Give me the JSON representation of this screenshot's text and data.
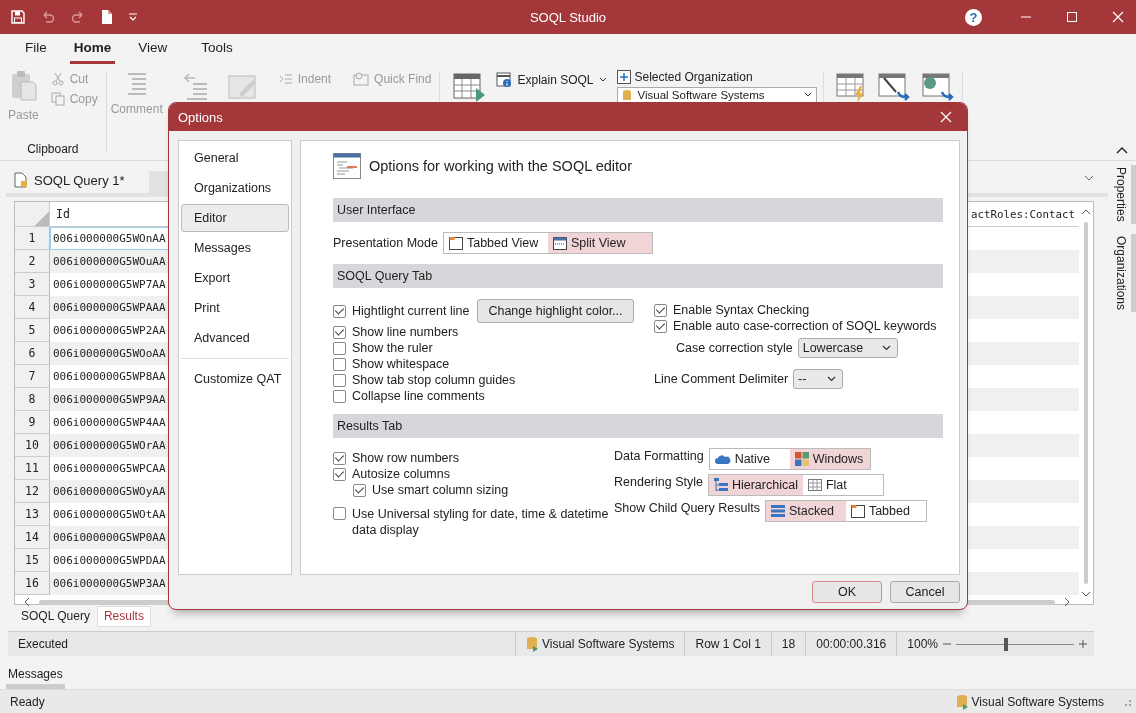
{
  "window": {
    "title": "SOQL Studio",
    "help": "?"
  },
  "menu_tabs": [
    {
      "label": "File",
      "selected": false
    },
    {
      "label": "Home",
      "selected": true
    },
    {
      "label": "View",
      "selected": false
    },
    {
      "label": "Tools",
      "selected": false
    }
  ],
  "ribbon": {
    "clipboard": {
      "label": "Clipboard",
      "paste": {
        "label": "Paste",
        "disabled": true
      },
      "cut": {
        "label": "Cut",
        "disabled": true
      },
      "copy": {
        "label": "Copy",
        "disabled": true
      }
    },
    "comment": {
      "label": "Comment",
      "disabled": true
    },
    "indent": {
      "label": "Indent",
      "disabled": true
    },
    "quick_find": {
      "label": "Quick Find",
      "disabled": true
    },
    "explain": {
      "label": "Explain SOQL",
      "disabled": false
    },
    "organization": {
      "label": "Selected Organization",
      "value": "Visual Software Systems"
    }
  },
  "document_tab": {
    "label": "SOQL Query 1*"
  },
  "grid": {
    "columns": [
      "Id",
      "actRoles:Contact"
    ],
    "rows": [
      {
        "number": "1",
        "id": "006i000000G5WOnAA",
        "selected": true
      },
      {
        "number": "2",
        "id": "006i000000G5WOuAA",
        "selected": false
      },
      {
        "number": "3",
        "id": "006i000000G5WP7AA",
        "selected": false
      },
      {
        "number": "4",
        "id": "006i000000G5WPAAA",
        "selected": false
      },
      {
        "number": "5",
        "id": "006i000000G5WP2AA",
        "selected": false
      },
      {
        "number": "6",
        "id": "006i000000G5WOoAA",
        "selected": false
      },
      {
        "number": "7",
        "id": "006i000000G5WP8AA",
        "selected": false
      },
      {
        "number": "8",
        "id": "006i000000G5WP9AA",
        "selected": false
      },
      {
        "number": "9",
        "id": "006i000000G5WP4AA",
        "selected": false
      },
      {
        "number": "10",
        "id": "006i000000G5WOrAA",
        "selected": false
      },
      {
        "number": "11",
        "id": "006i000000G5WPCAA",
        "selected": false
      },
      {
        "number": "12",
        "id": "006i000000G5WOyAA",
        "selected": false
      },
      {
        "number": "13",
        "id": "006i000000G5WOtAA",
        "selected": false
      },
      {
        "number": "14",
        "id": "006i000000G5WP0AA",
        "selected": false
      },
      {
        "number": "15",
        "id": "006i000000G5WPDAA",
        "selected": false
      },
      {
        "number": "16",
        "id": "006i000000G5WP3AA",
        "selected": false
      }
    ]
  },
  "bottom_tabs": [
    {
      "label": "SOQL Query",
      "selected": false
    },
    {
      "label": "Results",
      "selected": true
    }
  ],
  "query_status": {
    "state": "Executed",
    "organization": "Visual Software Systems",
    "position": "Row 1 Col 1",
    "count": "18",
    "elapsed": "00:00:00.316",
    "zoom": "100%",
    "zoom_slider": {
      "level": 0.42
    }
  },
  "side_panels": [
    "Properties",
    "Organizations"
  ],
  "messages_tab": "Messages",
  "status_bar": {
    "text": "Ready",
    "organization": "Visual Software Systems"
  },
  "dialog": {
    "title": "Options",
    "nav": [
      {
        "label": "General",
        "selected": false
      },
      {
        "label": "Organizations",
        "selected": false
      },
      {
        "label": "Editor",
        "selected": true
      },
      {
        "label": "Messages",
        "selected": false
      },
      {
        "label": "Export",
        "selected": false
      },
      {
        "label": "Print",
        "selected": false
      },
      {
        "label": "Advanced",
        "selected": false
      },
      {
        "label": "Customize QAT",
        "selected": false,
        "separated": true
      }
    ],
    "heading": "Options for working with the SOQL editor",
    "user_interface": {
      "title": "User Interface",
      "presentation_mode": {
        "label": "Presentation Mode",
        "options": [
          {
            "label": "Tabbed View",
            "kind": "tabbed",
            "selected": false
          },
          {
            "label": "Split View",
            "kind": "split",
            "selected": true
          }
        ]
      }
    },
    "query_tab": {
      "title": "SOQL Query Tab",
      "highlight_button": "Change highlight color...",
      "options": [
        {
          "label": "Hightlight current line",
          "checked": true
        },
        {
          "label": "Show line numbers",
          "checked": true
        },
        {
          "label": "Show the ruler",
          "checked": false
        },
        {
          "label": "Show whitespace",
          "checked": false
        },
        {
          "label": "Show tab stop column guides",
          "checked": false
        },
        {
          "label": "Collapse line comments",
          "checked": false
        }
      ],
      "syntax": [
        {
          "label": "Enable Syntax Checking",
          "checked": true
        },
        {
          "label": "Enable auto case-correction of SOQL keywords",
          "checked": true
        }
      ],
      "case_style": {
        "label": "Case correction style",
        "value": "Lowercase"
      },
      "comment_delimiter": {
        "label": "Line Comment Delimiter",
        "value": "--"
      }
    },
    "results_tab": {
      "title": "Results Tab",
      "options": [
        {
          "label": "Show row numbers",
          "checked": true
        },
        {
          "label": "Autosize columns",
          "checked": true,
          "children": [
            {
              "label": "Use smart column sizing",
              "checked": true
            }
          ]
        },
        {
          "label": "Use Universal styling for date, time & datetime data display",
          "checked": false
        }
      ],
      "choices": [
        {
          "label": "Data Formatting",
          "options": [
            {
              "label": "Native",
              "kind": "cloud",
              "selected": false
            },
            {
              "label": "Windows",
              "kind": "tiles",
              "selected": true
            }
          ]
        },
        {
          "label": "Rendering Style",
          "options": [
            {
              "label": "Hierarchical",
              "kind": "tree",
              "selected": true
            },
            {
              "label": "Flat",
              "kind": "table",
              "selected": false
            }
          ]
        },
        {
          "label": "Show Child Query Results",
          "options": [
            {
              "label": "Stacked",
              "kind": "stacked",
              "selected": true
            },
            {
              "label": "Tabbed",
              "kind": "tabbed",
              "selected": false
            }
          ]
        }
      ]
    },
    "buttons": [
      {
        "label": "OK",
        "default": true
      },
      {
        "label": "Cancel",
        "default": false
      }
    ]
  }
}
